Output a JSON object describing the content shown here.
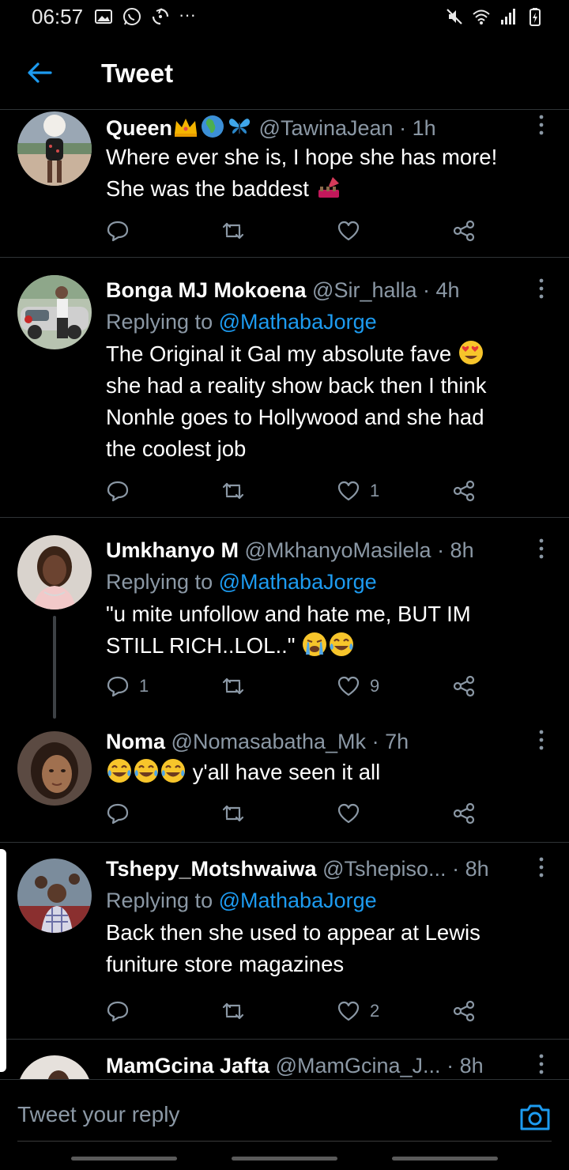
{
  "status_bar": {
    "time": "06:57",
    "more": "···",
    "left_icons": [
      "image-icon",
      "whatsapp-icon",
      "sync-icon"
    ],
    "right_icons": [
      "mute-icon",
      "wifi-icon",
      "signal-icon",
      "battery-icon"
    ]
  },
  "header": {
    "title": "Tweet",
    "back_icon": "arrow-left-icon"
  },
  "colors": {
    "accent": "#1d9bf0",
    "muted": "#8b98a5",
    "divider": "#2f3336",
    "background": "#000000"
  },
  "tweets": [
    {
      "name": "Queen",
      "name_emoji": [
        "crown-emoji",
        "earth-africa-emoji",
        "butterfly-emoji"
      ],
      "handle": "@TawinaJean",
      "time": "· 1h",
      "replying_to": "",
      "text_lines": [
        "Where ever she is, I hope she has more!",
        "She was the baddest"
      ],
      "text_emoji": "nail-polish-emoji",
      "reply_count": "",
      "retweet_count": "",
      "like_count": ""
    },
    {
      "name": "Bonga MJ Mokoena",
      "handle": "@Sir_halla",
      "time": "· 4h",
      "replying_prefix": "Replying to",
      "replying_to": "@MathabaJorge",
      "text_lines": [
        "The Original it Gal my absolute fave",
        "she had a reality show back then I think",
        "Nonhle goes to Hollywood and she had",
        "the coolest job"
      ],
      "text_emoji": "heart-eyes-emoji",
      "reply_count": "",
      "retweet_count": "",
      "like_count": "1"
    },
    {
      "name": "Umkhanyo M",
      "handle": "@MkhanyoMasilela",
      "time": "· 8h",
      "replying_prefix": "Replying to",
      "replying_to": "@MathabaJorge",
      "text_lines": [
        "\"u mite unfollow and hate me, BUT IM",
        "STILL RICH..LOL..\""
      ],
      "text_emoji": "loudly-crying-emoji, tears-of-joy-emoji",
      "reply_count": "1",
      "retweet_count": "",
      "like_count": "9"
    },
    {
      "name": "Noma",
      "handle": "@Nomasabatha_Mk",
      "time": "· 7h",
      "replying_to": "",
      "text_lines": [
        "y'all have seen it all"
      ],
      "text_emoji": "tears-of-joy-emoji x3",
      "reply_count": "",
      "retweet_count": "",
      "like_count": ""
    },
    {
      "name": "Tshepy_Motshwaiwa",
      "handle": "@Tshepiso...",
      "time": "· 8h",
      "replying_prefix": "Replying to",
      "replying_to": "@MathabaJorge",
      "text_lines": [
        "Back then she used to appear at Lewis",
        "funiture store magazines"
      ],
      "reply_count": "",
      "retweet_count": "",
      "like_count": "2"
    },
    {
      "name": "MamGcina Jafta",
      "handle": "@MamGcina_J...",
      "time": "· 8h"
    }
  ],
  "composer": {
    "placeholder": "Tweet your reply",
    "camera_icon": "camera-icon"
  }
}
